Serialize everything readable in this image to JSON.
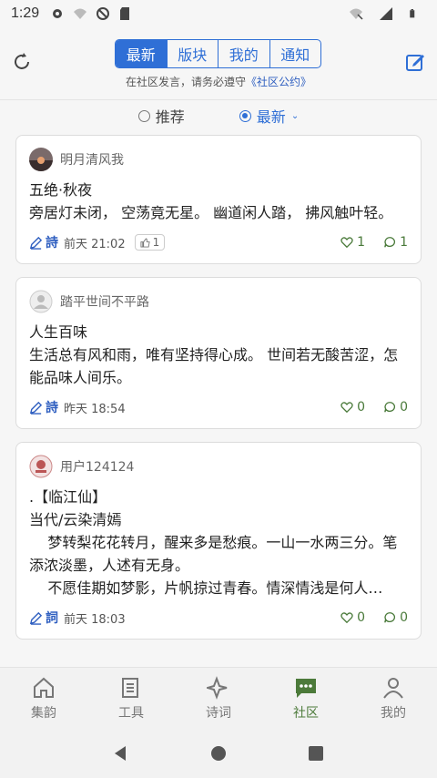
{
  "status_bar": {
    "time": "1:29"
  },
  "header": {
    "tabs": [
      {
        "label": "最新",
        "active": true
      },
      {
        "label": "版块",
        "active": false
      },
      {
        "label": "我的",
        "active": false
      },
      {
        "label": "通知",
        "active": false
      }
    ],
    "notice_prefix": "在社区发言，请务必遵守",
    "notice_link": "《社区公约》"
  },
  "filter": {
    "recommend_label": "推荐",
    "latest_label": "最新",
    "selected": "最新"
  },
  "posts": [
    {
      "user": "明月清风我",
      "title": "五绝·秋夜",
      "body": "旁居灯未闭， 空荡竟无星。 幽道闲人踏， 拂风触叶轻。",
      "kind": "詩",
      "time": "前天 21:02",
      "like_chip": "1",
      "likes": "1",
      "comments": "1"
    },
    {
      "user": "踏平世间不平路",
      "title": "人生百味",
      "body": "生活总有风和雨，唯有坚持得心成。 世间若无酸苦涩，怎能品味人间乐。",
      "kind": "詩",
      "time": "昨天 18:54",
      "likes": "0",
      "comments": "0"
    },
    {
      "user": "用户124124",
      "title": ".【临江仙】",
      "body": "当代/云染清嫣\n    梦转梨花花转月，醒来多是愁痕。一山一水两三分。笔添浓淡墨，人述有无身。\n    不愿佳期如梦影，片帆掠过青春。情深情浅是何人…",
      "kind": "詞",
      "time": "前天 18:03",
      "likes": "0",
      "comments": "0"
    }
  ],
  "bottom_nav": [
    {
      "label": "集韵",
      "icon": "home-icon",
      "active": false
    },
    {
      "label": "工具",
      "icon": "book-icon",
      "active": false
    },
    {
      "label": "诗词",
      "icon": "sparkle-icon",
      "active": false
    },
    {
      "label": "社区",
      "icon": "chat-icon",
      "active": true
    },
    {
      "label": "我的",
      "icon": "person-icon",
      "active": false
    }
  ],
  "colors": {
    "accent": "#2f6fd6",
    "nav_active": "#4c7a3a"
  }
}
